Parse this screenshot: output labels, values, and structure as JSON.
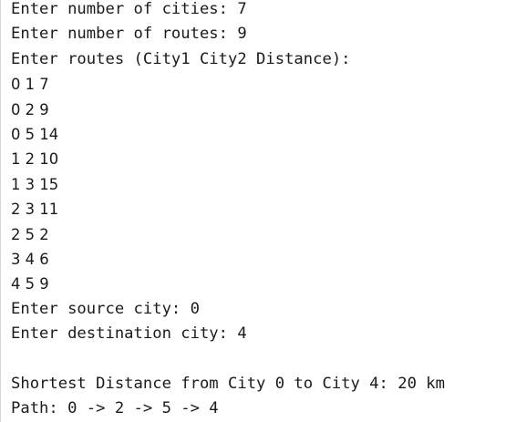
{
  "console": {
    "lines": [
      "Enter number of cities: 7",
      "Enter number of routes: 9",
      "Enter routes (City1 City2 Distance):",
      "0 1 7",
      "0 2 9",
      "0 5 14",
      "1 2 10",
      "1 3 15",
      "2 3 11",
      "2 5 2",
      "3 4 6",
      "4 5 9",
      "Enter source city: 0",
      "Enter destination city: 4",
      "",
      "Shortest Distance from City 0 to City 4: 20 km",
      "Path: 0 -> 2 -> 5 -> 4"
    ]
  }
}
